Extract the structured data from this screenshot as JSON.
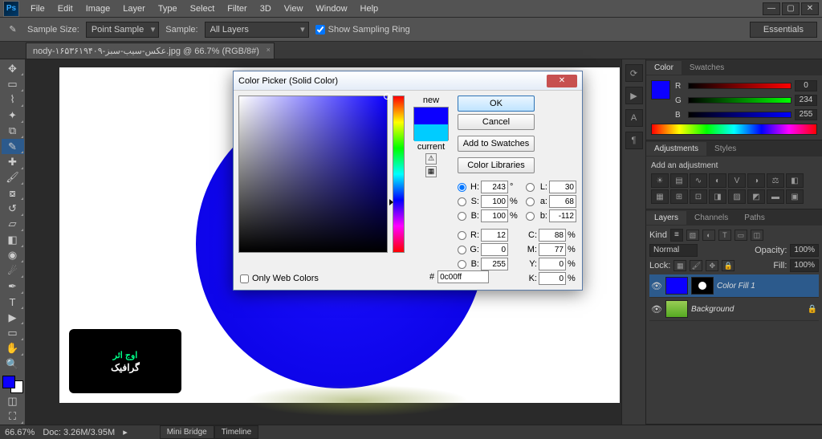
{
  "menubar": {
    "items": [
      "File",
      "Edit",
      "Image",
      "Layer",
      "Type",
      "Select",
      "Filter",
      "3D",
      "View",
      "Window",
      "Help"
    ]
  },
  "optbar": {
    "sample_size_label": "Sample Size:",
    "sample_size_value": "Point Sample",
    "sample_label": "Sample:",
    "sample_value": "All Layers",
    "show_ring": "Show Sampling Ring",
    "workspace": "Essentials"
  },
  "doc": {
    "tab": "nody-۱۶۵۳۶۱۹۴۰۹-عکس-سیب-سبز.jpg @ 66.7% (RGB/8#)",
    "zoom": "66.67%",
    "docsize": "Doc: 3.26M/3.95M"
  },
  "bottom_tabs": {
    "a": "Mini Bridge",
    "b": "Timeline"
  },
  "panels": {
    "color": {
      "tab1": "Color",
      "tab2": "Swatches",
      "r": "0",
      "g": "234",
      "b": "255"
    },
    "adjust": {
      "tab1": "Adjustments",
      "tab2": "Styles",
      "title": "Add an adjustment"
    },
    "layers": {
      "tab1": "Layers",
      "tab2": "Channels",
      "tab3": "Paths",
      "kind": "Kind",
      "blend": "Normal",
      "opacity_label": "Opacity:",
      "opacity": "100%",
      "lock_label": "Lock:",
      "fill_label": "Fill:",
      "fill": "100%",
      "layer1": "Color Fill 1",
      "layer2": "Background"
    }
  },
  "dialog": {
    "title": "Color Picker (Solid Color)",
    "ok": "OK",
    "cancel": "Cancel",
    "add_swatches": "Add to Swatches",
    "libs": "Color Libraries",
    "new": "new",
    "current": "current",
    "only_web": "Only Web Colors",
    "h_label": "H:",
    "h": "243",
    "h_unit": "°",
    "s_label": "S:",
    "s": "100",
    "s_unit": "%",
    "bb_label": "B:",
    "bb": "100",
    "bb_unit": "%",
    "r_label": "R:",
    "r": "12",
    "g_label": "G:",
    "g": "0",
    "b_label": "B:",
    "b": "255",
    "l_label": "L:",
    "l": "30",
    "a_label": "a:",
    "a": "68",
    "lb_label": "b:",
    "lb": "-112",
    "c_label": "C:",
    "c": "88",
    "c_unit": "%",
    "m_label": "M:",
    "m": "77",
    "m_unit": "%",
    "y_label": "Y:",
    "y": "0",
    "y_unit": "%",
    "k_label": "K:",
    "k": "0",
    "k_unit": "%",
    "hex": "0c00ff"
  },
  "logo": {
    "a": "اوج اثر",
    "b": "گرافیک"
  }
}
